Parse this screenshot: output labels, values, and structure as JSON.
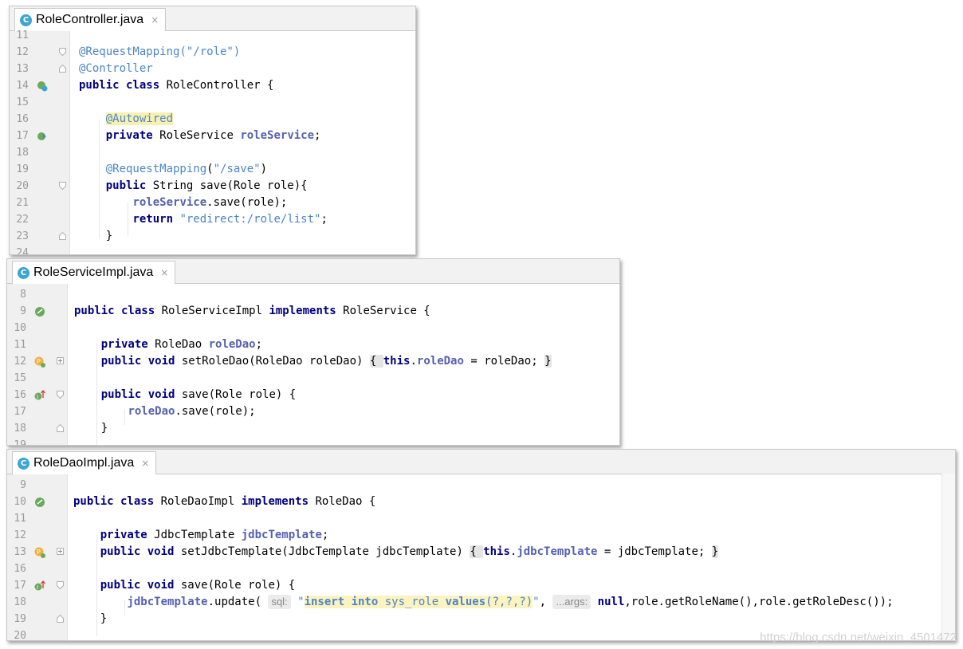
{
  "panel1": {
    "tab": {
      "icon": "C",
      "title": "RoleController.java",
      "close": "×"
    },
    "lines": [
      {
        "n": "11",
        "code": ""
      },
      {
        "n": "12",
        "code": "@RequestMapping(\"/role\")"
      },
      {
        "n": "13",
        "code": "@Controller"
      },
      {
        "n": "14",
        "code": "public class RoleController {"
      },
      {
        "n": "15",
        "code": ""
      },
      {
        "n": "16",
        "code": "    @Autowired"
      },
      {
        "n": "17",
        "code": "    private RoleService roleService;"
      },
      {
        "n": "18",
        "code": ""
      },
      {
        "n": "19",
        "code": "    @RequestMapping(\"/save\")"
      },
      {
        "n": "20",
        "code": "    public String save(Role role){"
      },
      {
        "n": "21",
        "code": "        roleService.save(role);"
      },
      {
        "n": "22",
        "code": "        return \"redirect:/role/list\";"
      },
      {
        "n": "23",
        "code": "    }"
      },
      {
        "n": "24",
        "code": ""
      }
    ]
  },
  "panel2": {
    "tab": {
      "icon": "C",
      "title": "RoleServiceImpl.java",
      "close": "×"
    },
    "lines": [
      {
        "n": "8",
        "code": ""
      },
      {
        "n": "9",
        "code": "public class RoleServiceImpl implements RoleService {"
      },
      {
        "n": "10",
        "code": ""
      },
      {
        "n": "11",
        "code": "    private RoleDao roleDao;"
      },
      {
        "n": "12",
        "code": "    public void setRoleDao(RoleDao roleDao) { this.roleDao = roleDao; }"
      },
      {
        "n": "15",
        "code": ""
      },
      {
        "n": "16",
        "code": "    public void save(Role role) {"
      },
      {
        "n": "17",
        "code": "        roleDao.save(role);"
      },
      {
        "n": "18",
        "code": "    }"
      },
      {
        "n": "19",
        "code": ""
      }
    ]
  },
  "panel3": {
    "tab": {
      "icon": "C",
      "title": "RoleDaoImpl.java",
      "close": "×"
    },
    "lines": [
      {
        "n": "9",
        "code": ""
      },
      {
        "n": "10",
        "code": "public class RoleDaoImpl implements RoleDao {"
      },
      {
        "n": "11",
        "code": ""
      },
      {
        "n": "12",
        "code": "    private JdbcTemplate jdbcTemplate;"
      },
      {
        "n": "13",
        "code": "    public void setJdbcTemplate(JdbcTemplate jdbcTemplate) { this.jdbcTemplate = jdbcTemplate; }"
      },
      {
        "n": "16",
        "code": ""
      },
      {
        "n": "17",
        "code": "    public void save(Role role) {"
      },
      {
        "n": "18",
        "code": "        jdbcTemplate.update( sql: \"insert into sys_role values(?,?,?)\", ...args: null,role.getRoleName(),role.getRoleDesc());"
      },
      {
        "n": "19",
        "code": "    }"
      },
      {
        "n": "20",
        "code": ""
      }
    ],
    "hints": {
      "sql": "sql:",
      "args": "...args:"
    }
  },
  "watermark": "https://blog.csdn.net/weixin_4501472",
  "colors": {
    "keyword": "#000080",
    "annotation": "#4a86c8",
    "string": "#4d83c6",
    "field": "#5560b0",
    "gutter": "#f0f0f0",
    "tab_icon": "#3ba5d4"
  }
}
